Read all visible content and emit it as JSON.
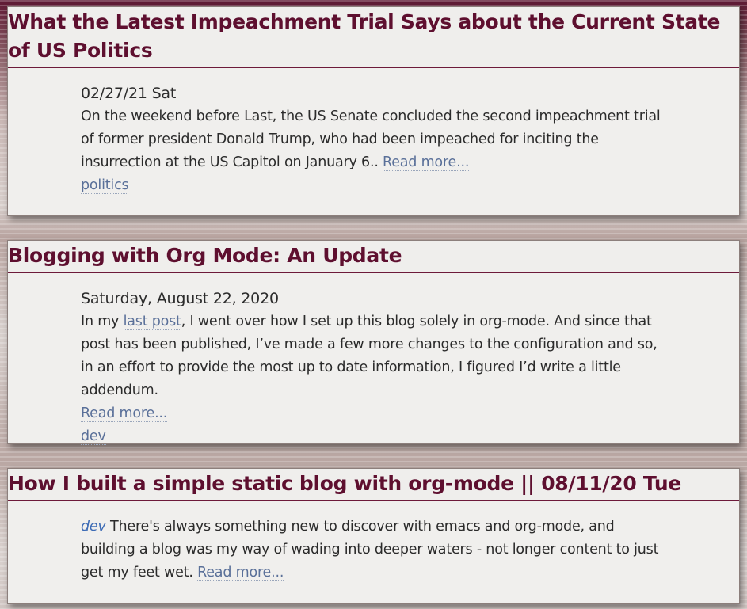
{
  "posts": [
    {
      "title": "What the Latest Impeachment Trial Says about the Current State of US Politics",
      "date": "02/27/21 Sat",
      "excerpt": "On the weekend before Last, the US Senate concluded the second impeachment trial of former president Donald Trump, who had been impeached for inciting the insurrection at the US Capitol on January 6.. ",
      "read_more": "Read more...",
      "tag": "politics"
    },
    {
      "title": "Blogging with Org Mode: An Update",
      "date": "Saturday, August 22, 2020",
      "excerpt_before_link": "In my ",
      "inline_link": "last post",
      "excerpt_after_link": ", I went over how I set up this blog solely in org-mode. And since that post has been published, I’ve made a few more changes to the configuration and so, in an effort to provide the most up to date information, I figured I’d write a little addendum.",
      "read_more": "Read more...",
      "tag": "dev"
    },
    {
      "title": "How I built a simple static blog with org-mode || 08/11/20 Tue",
      "tag": "dev",
      "excerpt": " There's always something new to discover with emacs and org-mode, and building a blog was my way of wading into deeper waters - not longer content to just get my feet wet. ",
      "read_more": "Read more..."
    }
  ]
}
